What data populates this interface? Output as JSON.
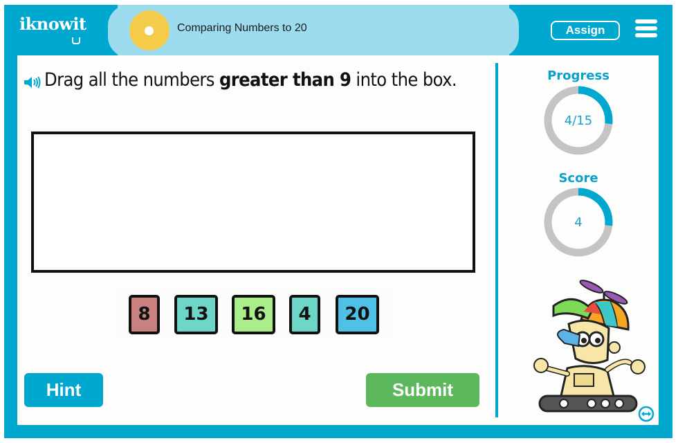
{
  "header": {
    "logo_text": "iknowit",
    "lesson_title": "Comparing Numbers to 20",
    "assign_label": "Assign",
    "menu_icon": "hamburger-menu-icon"
  },
  "question": {
    "audio_icon": "speaker-icon",
    "prefix": "Drag all the numbers ",
    "emphasis": "greater than 9",
    "suffix": " into the box."
  },
  "drop_box": {
    "items": []
  },
  "tiles": [
    {
      "value": "8",
      "color": "#c98080"
    },
    {
      "value": "13",
      "color": "#6dd6c6"
    },
    {
      "value": "16",
      "color": "#aaee8a"
    },
    {
      "value": "4",
      "color": "#6dd6c6"
    },
    {
      "value": "20",
      "color": "#4fc1e6"
    }
  ],
  "buttons": {
    "hint_label": "Hint",
    "submit_label": "Submit"
  },
  "progress": {
    "label": "Progress",
    "display": "4/15",
    "current": 4,
    "total": 15,
    "fraction": 0.267
  },
  "score": {
    "label": "Score",
    "display": "4",
    "fraction": 0.267
  },
  "mascot": {
    "icon": "robot-mascot-icon"
  },
  "colors": {
    "brand_teal": "#00a7cf",
    "header_pill": "#9ddcee",
    "lesson_dot": "#f4cc4a",
    "submit_green": "#5cb85c",
    "ring_track": "#c4c4c4"
  }
}
